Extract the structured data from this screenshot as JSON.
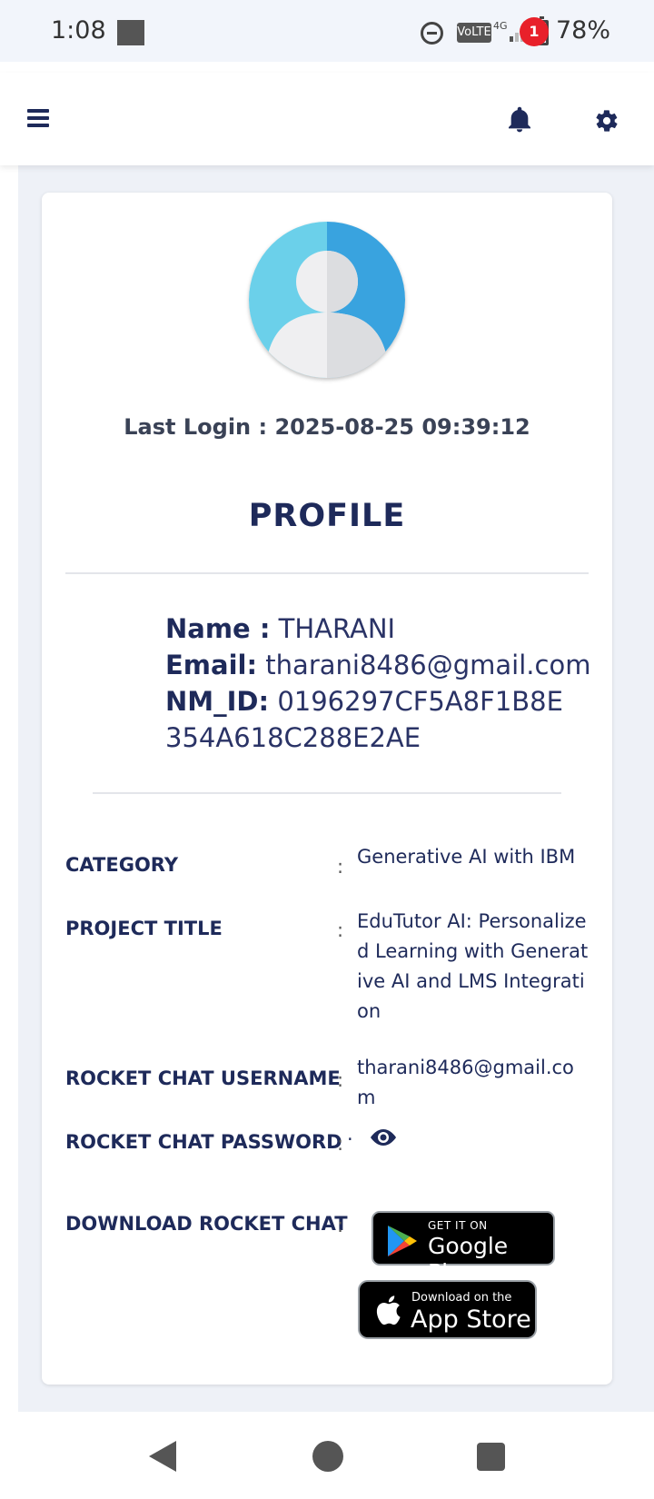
{
  "status_bar": {
    "time": "1:08",
    "network": "VoLTE",
    "network_type": "4G",
    "battery": "78%"
  },
  "header": {
    "menu_icon": "hamburger-menu-icon",
    "notification_icon": "bell-icon",
    "notification_count": "1",
    "settings_icon": "gear-icon"
  },
  "profile": {
    "last_login": "Last Login : 2025-08-25 09:39:12",
    "title": "PROFILE",
    "name_label": "Name :",
    "name_value": "THARANI",
    "email_label": "Email:",
    "email_value": "tharani8486@gmail.com",
    "nm_label": "NM_ID:",
    "nm_value": "0196297CF5A8F1B8E354A618C288E2AE"
  },
  "details": {
    "category_label": "CATEGORY",
    "category_value": "Generative AI with IBM",
    "project_label": "PROJECT TITLE",
    "project_value": "EduTutor AI: Personalized Learning with Generative AI and LMS Integration",
    "rc_username_label": "ROCKET CHAT USERNAME",
    "rc_username_value": "tharani8486@gmail.com",
    "rc_password_label": "ROCKET CHAT PASSWORD",
    "rc_password_value": "·",
    "download_label": "DOWNLOAD ROCKET CHAT",
    "colon": ":"
  },
  "store_badges": {
    "google_small": "GET IT ON",
    "google_big": "Google Play",
    "apple_small": "Download on the",
    "apple_big": "App Store"
  },
  "colors": {
    "primary": "#1e2a5a",
    "badge": "#e8202a",
    "background": "#eef1f7"
  }
}
